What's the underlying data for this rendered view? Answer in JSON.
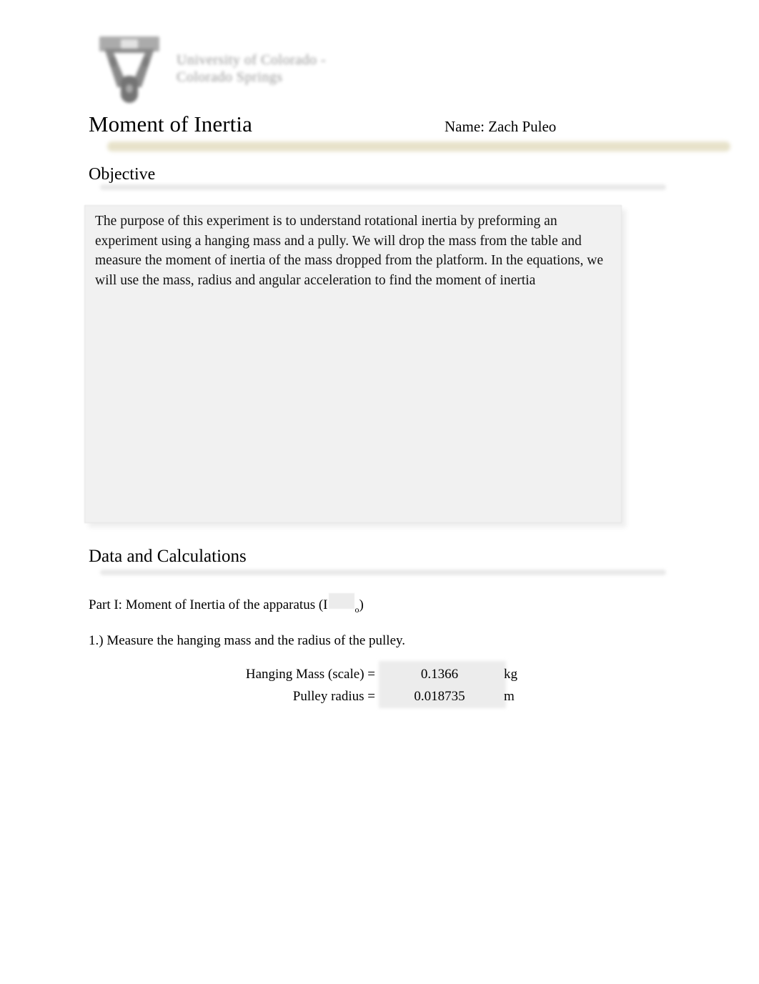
{
  "header": {
    "logo_icon": "uccs-mountain-lion-logo",
    "logo_line1": "University of Colorado -",
    "logo_line2": "Colorado Springs"
  },
  "title": "Moment of Inertia",
  "student": "Name: Zach Puleo",
  "sections": {
    "objective": {
      "heading": "Objective",
      "body": "The purpose of this experiment is to understand rotational inertia by preforming an experiment using a hanging mass and a pully. We will drop the mass from the table and measure the moment of inertia of the mass dropped from the platform. In the equations, we will use the mass, radius and angular acceleration to find the moment of inertia"
    },
    "data": {
      "heading": "Data and Calculations",
      "part_label_prefix": "Part I: Moment of Inertia of the apparatus (I",
      "part_label_subscript": "o",
      "part_label_suffix": ")",
      "step1": "1.)  Measure the hanging mass and the radius of the pulley.",
      "measurements": [
        {
          "label": "Hanging Mass (scale) =",
          "value": "0.1366",
          "unit": "kg"
        },
        {
          "label": "Pulley radius =",
          "value": "0.018735",
          "unit": "m"
        }
      ]
    }
  },
  "colors": {
    "page_background": "#ffffff",
    "accent_bar": "#e6e1c8",
    "section_rule": "#e9e9e9",
    "text_box_fill": "#f1f1f1",
    "form_field_fill": "#ececec",
    "text": "#000000"
  }
}
